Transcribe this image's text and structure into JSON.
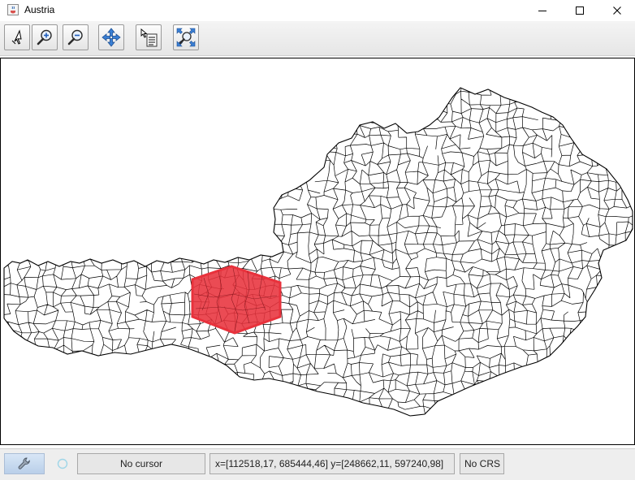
{
  "window": {
    "title": "Austria",
    "app_icon": "java-cup-icon",
    "controls": [
      "minimize-icon",
      "maximize-icon",
      "close-icon"
    ]
  },
  "toolbar": {
    "buttons": [
      {
        "name": "pointer-select",
        "icon": "arrow-cursor-icon"
      },
      {
        "name": "zoom-in",
        "icon": "zoom-in-magnifier-icon"
      },
      {
        "name": "zoom-out",
        "icon": "zoom-out-magnifier-icon"
      },
      {
        "name": "pan",
        "icon": "four-arrow-move-icon"
      },
      {
        "name": "info",
        "icon": "feature-info-icon"
      },
      {
        "name": "zoom-full-extent",
        "icon": "zoom-extent-icon"
      }
    ]
  },
  "map": {
    "layer": "Austria municipality boundaries",
    "fill_color": "#ffffff",
    "stroke_color": "#000000",
    "highlight": {
      "shape": "hexagon",
      "fill": "#e8323c",
      "stroke": "#e8323c"
    }
  },
  "statusbar": {
    "cursor_text": "No cursor",
    "bounds_text": "x=[112518,17, 685444,46] y=[248662,11, 597240,98]",
    "crs_text": "No CRS",
    "tool_icon": "wrench-icon",
    "busy_icon": "spinner-icon"
  },
  "colors": {
    "highlight": "#e8323c",
    "statusbar_tool_bg": "#c8dbf0"
  }
}
